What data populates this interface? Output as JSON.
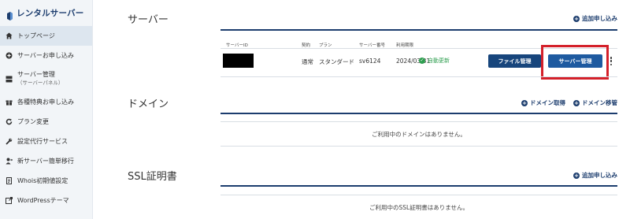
{
  "brand": {
    "name": "レンタルサーバー"
  },
  "sidebar": {
    "items": [
      {
        "label": "トップページ",
        "icon": "home-icon",
        "active": true
      },
      {
        "label": "サーバーお申し込み",
        "icon": "plus-circle-icon"
      },
      {
        "label": "サーバー管理",
        "sub": "（サーバーパネル）",
        "icon": "server-icon"
      },
      {
        "label": "各種特典お申し込み",
        "icon": "gift-icon"
      },
      {
        "label": "プラン変更",
        "icon": "refresh-icon"
      },
      {
        "label": "設定代行サービス",
        "icon": "wrench-icon"
      },
      {
        "label": "新サーバー簡単移行",
        "icon": "user-move-icon"
      },
      {
        "label": "Whois初期値設定",
        "icon": "document-icon"
      },
      {
        "label": "WordPressテーマ",
        "icon": "external-icon"
      }
    ]
  },
  "server": {
    "title": "サーバー",
    "add_label": "追加申し込み",
    "columns": {
      "server_id": "サーバーID",
      "contract": "契約",
      "plan": "プラン",
      "number": "サーバー番号",
      "expiry": "利用期限"
    },
    "row": {
      "contract": "通常",
      "plan": "スタンダード",
      "number": "sv6124",
      "expiry": "2024/03/31",
      "status": "自動更新"
    },
    "file_button": "ファイル管理",
    "manage_button": "サーバー管理"
  },
  "domain": {
    "title": "ドメイン",
    "acquire_label": "ドメイン取得",
    "transfer_label": "ドメイン移管",
    "empty": "ご利用中のドメインはありません。"
  },
  "ssl": {
    "title": "SSL証明書",
    "add_label": "追加申し込み",
    "empty": "ご利用中のSSL証明書はありません。"
  },
  "colors": {
    "navy": "#1c3d6e",
    "button": "#17457c",
    "highlight": "#d4202a",
    "success": "#2e9e4f",
    "sidebar_bg": "#f2f5f8"
  }
}
